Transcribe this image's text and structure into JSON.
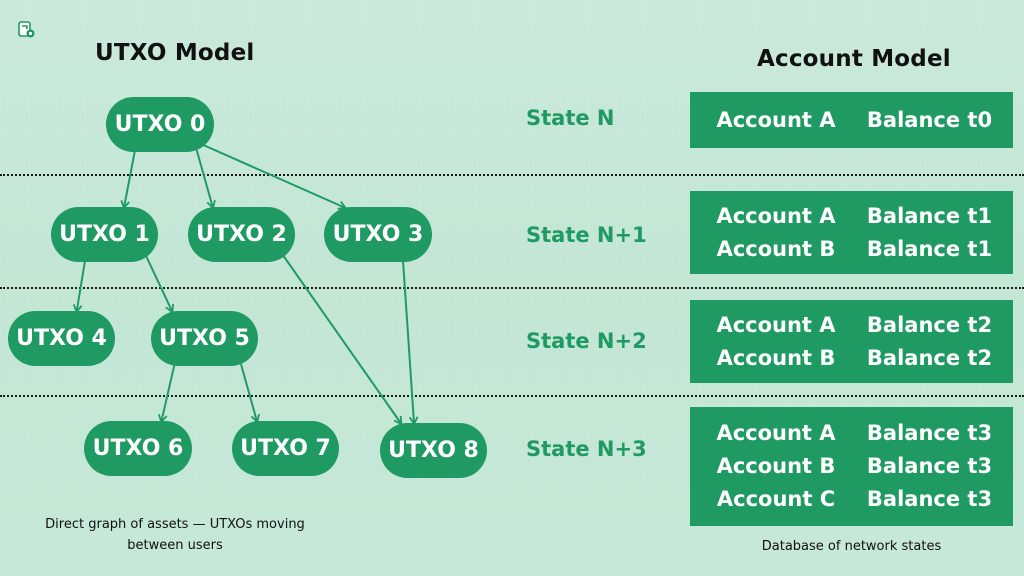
{
  "logo": {
    "icon": "document-gear-icon",
    "color": "#1f9a63"
  },
  "colors": {
    "accent": "#1f9a63",
    "background": "#c6e8d8",
    "text": "#111111"
  },
  "utxo_model": {
    "title": "UTXO Model",
    "nodes": [
      {
        "id": "utxo0",
        "label": "UTXO 0"
      },
      {
        "id": "utxo1",
        "label": "UTXO 1"
      },
      {
        "id": "utxo2",
        "label": "UTXO 2"
      },
      {
        "id": "utxo3",
        "label": "UTXO 3"
      },
      {
        "id": "utxo4",
        "label": "UTXO 4"
      },
      {
        "id": "utxo5",
        "label": "UTXO 5"
      },
      {
        "id": "utxo6",
        "label": "UTXO 6"
      },
      {
        "id": "utxo7",
        "label": "UTXO 7"
      },
      {
        "id": "utxo8",
        "label": "UTXO 8"
      }
    ],
    "edges": [
      {
        "from": "utxo0",
        "to": "utxo1"
      },
      {
        "from": "utxo0",
        "to": "utxo2"
      },
      {
        "from": "utxo0",
        "to": "utxo3"
      },
      {
        "from": "utxo1",
        "to": "utxo4"
      },
      {
        "from": "utxo1",
        "to": "utxo5"
      },
      {
        "from": "utxo5",
        "to": "utxo6"
      },
      {
        "from": "utxo5",
        "to": "utxo7"
      },
      {
        "from": "utxo2",
        "to": "utxo8"
      },
      {
        "from": "utxo3",
        "to": "utxo8"
      }
    ],
    "caption": "Direct graph of assets — UTXOs moving between users"
  },
  "states": [
    {
      "label": "State N"
    },
    {
      "label": "State N+1"
    },
    {
      "label": "State N+2"
    },
    {
      "label": "State N+3"
    }
  ],
  "account_model": {
    "title": "Account Model",
    "states": [
      {
        "rows": [
          {
            "account": "Account A",
            "balance": "Balance t0"
          }
        ]
      },
      {
        "rows": [
          {
            "account": "Account A",
            "balance": "Balance t1"
          },
          {
            "account": "Account B",
            "balance": "Balance t1"
          }
        ]
      },
      {
        "rows": [
          {
            "account": "Account A",
            "balance": "Balance t2"
          },
          {
            "account": "Account B",
            "balance": "Balance t2"
          }
        ]
      },
      {
        "rows": [
          {
            "account": "Account A",
            "balance": "Balance t3"
          },
          {
            "account": "Account B",
            "balance": "Balance t3"
          },
          {
            "account": "Account C",
            "balance": "Balance t3"
          }
        ]
      }
    ],
    "caption": "Database of network states"
  }
}
